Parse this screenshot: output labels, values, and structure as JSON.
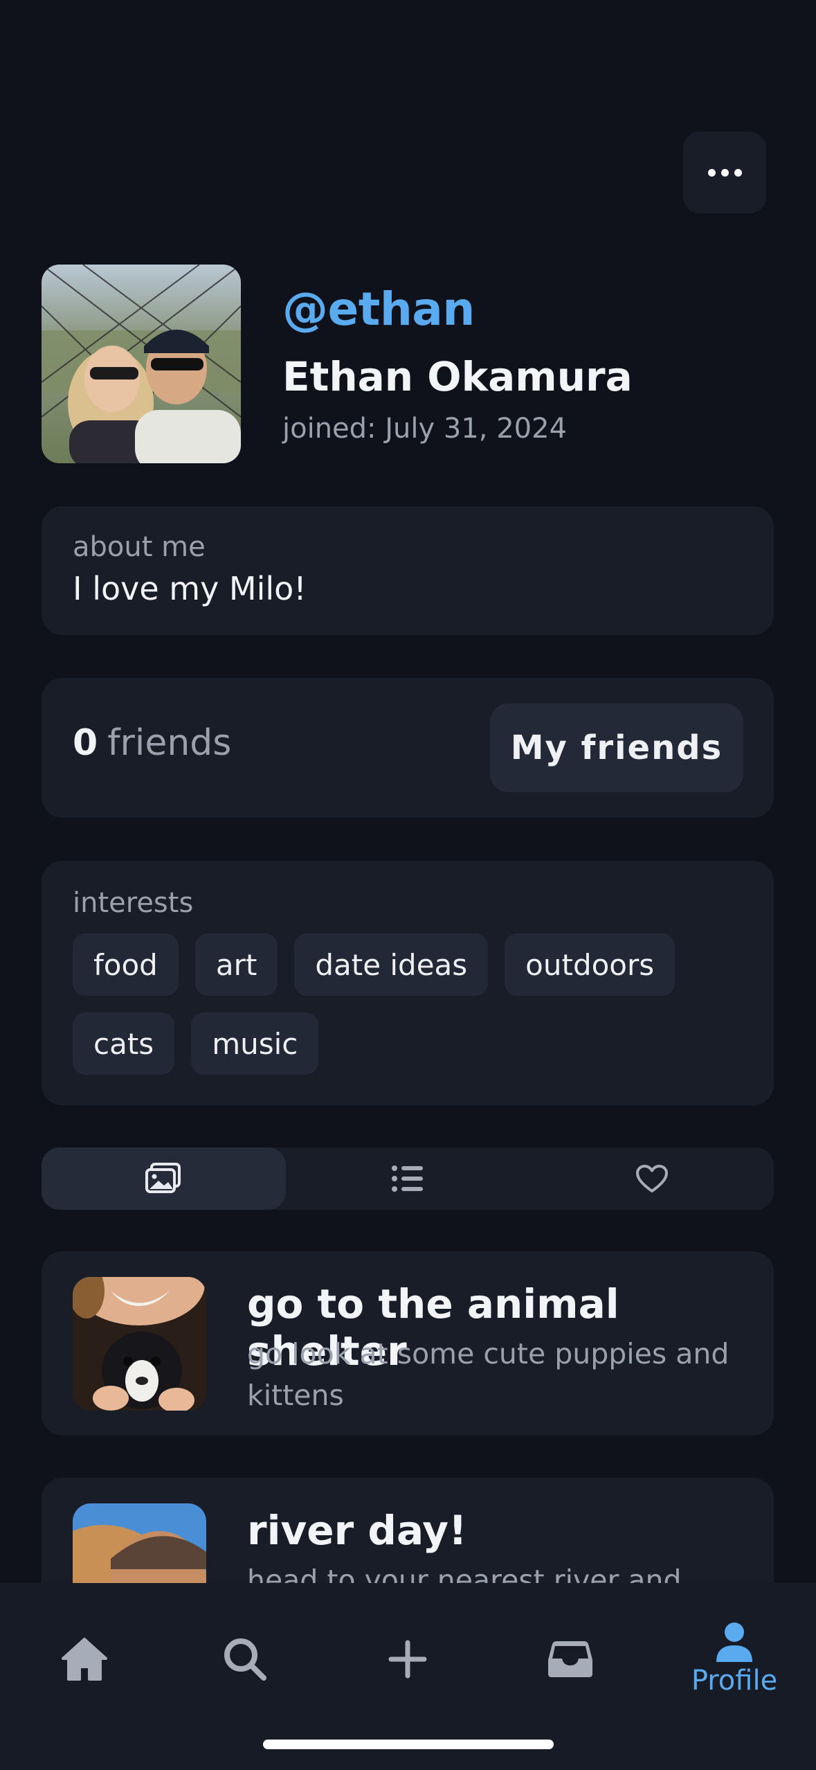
{
  "profile": {
    "handle": "@ethan",
    "full_name": "Ethan Okamura",
    "joined": "joined: July 31, 2024"
  },
  "about": {
    "label": "about me",
    "text": "I love my Milo!"
  },
  "friends": {
    "count": "0",
    "label": "friends",
    "button_label": "My friends"
  },
  "interests": {
    "label": "interests",
    "items": [
      "food",
      "art",
      "date ideas",
      "outdoors",
      "cats",
      "music"
    ]
  },
  "tabs": [
    {
      "icon": "photos-icon",
      "active": true
    },
    {
      "icon": "list-icon",
      "active": false
    },
    {
      "icon": "heart-icon",
      "active": false
    }
  ],
  "posts": [
    {
      "title": "go to the animal shelter",
      "description": "go look at some cute puppies and kittens"
    },
    {
      "title": "river day!",
      "description": "head to your nearest river and"
    }
  ],
  "nav": {
    "items": [
      "home-icon",
      "search-icon",
      "plus-icon",
      "inbox-icon",
      "profile-icon"
    ],
    "active_label": "Profile"
  },
  "colors": {
    "background": "#0f121a",
    "card": "#181d28",
    "accent": "#5aaaf0"
  }
}
